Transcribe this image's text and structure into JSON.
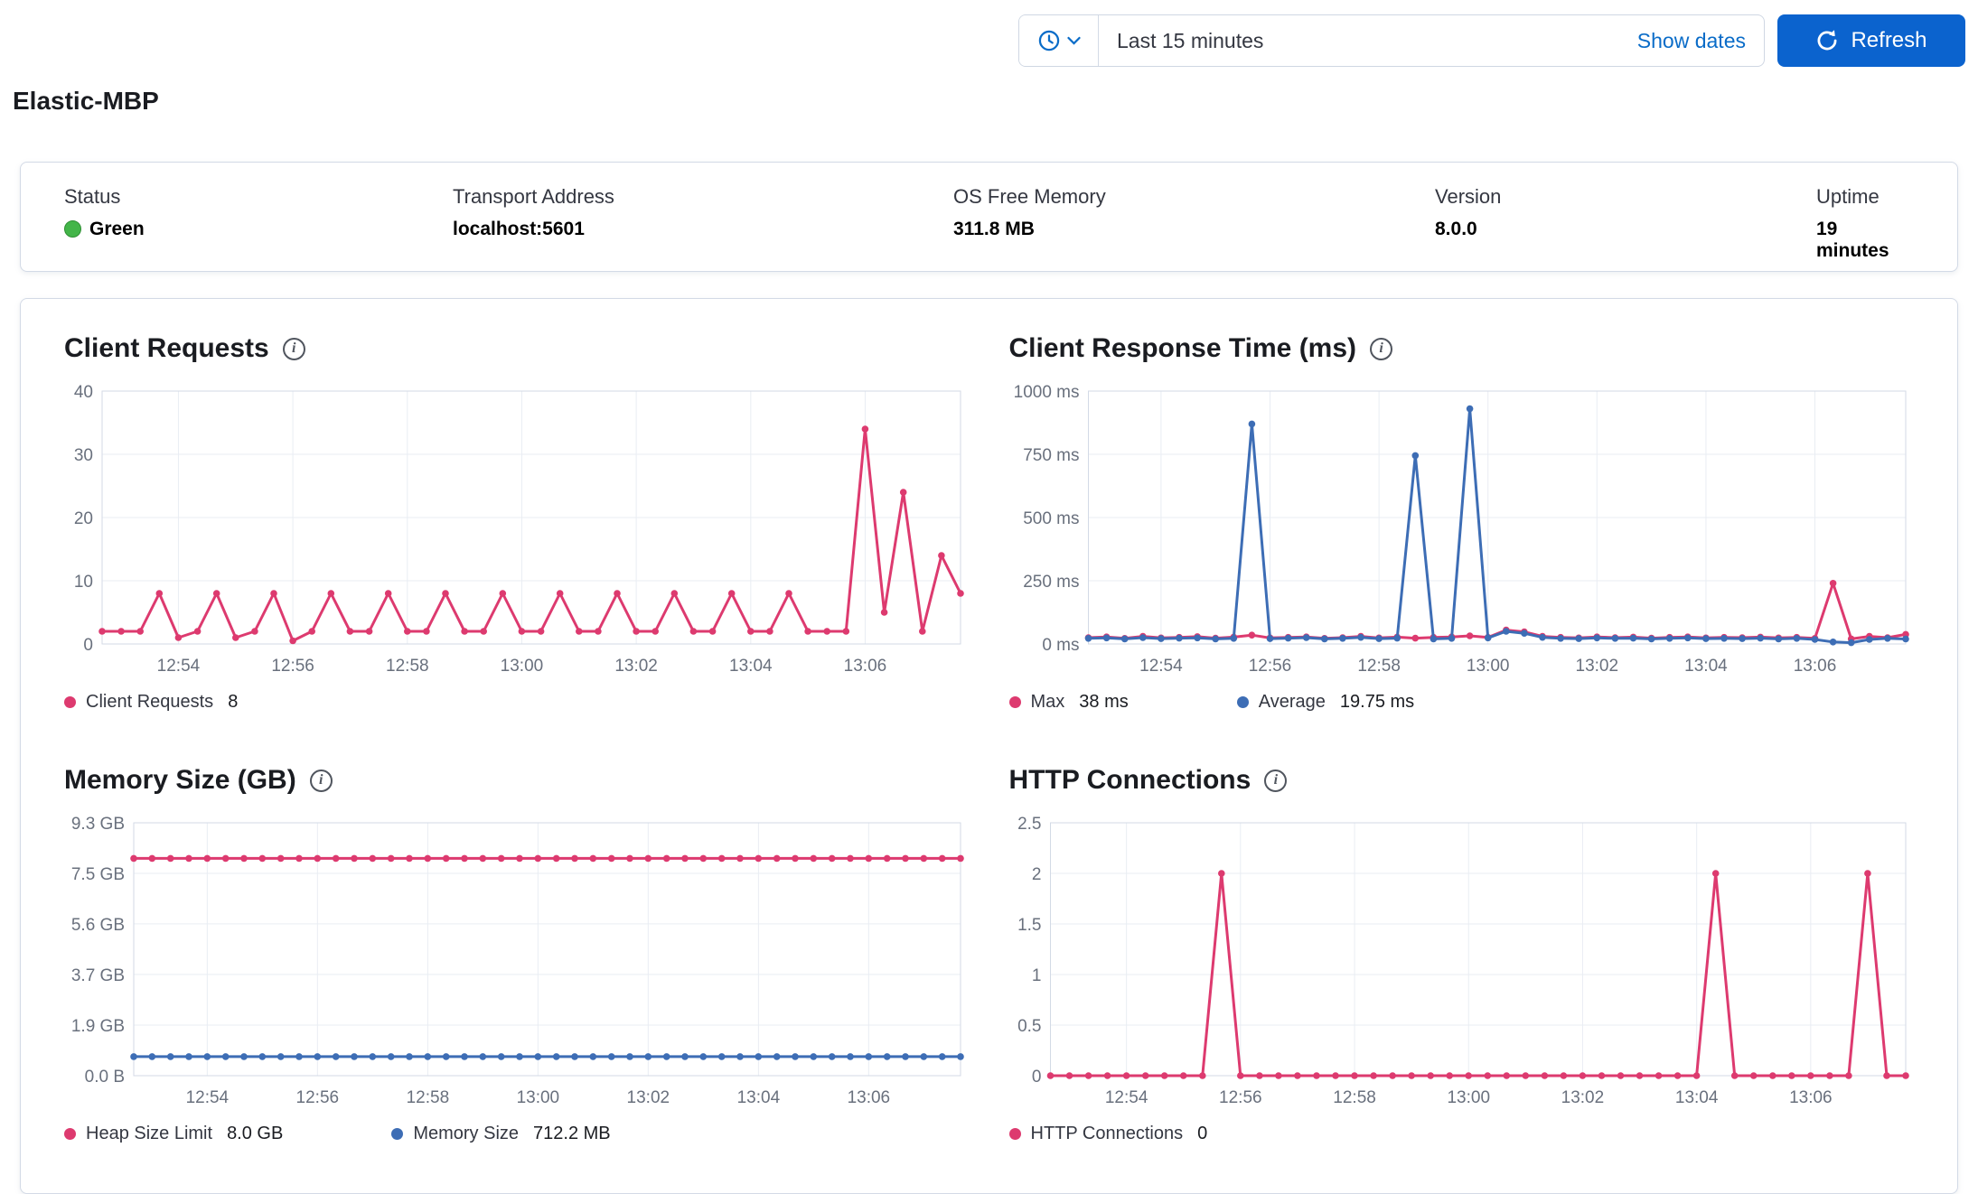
{
  "colors": {
    "pink": "#dd3a6f",
    "blue": "#3d6db5",
    "primary_button": "#0b63ce",
    "link": "#0a6cc8",
    "status_green": "#43b549"
  },
  "topbar": {
    "time_range": "Last 15 minutes",
    "show_dates_label": "Show dates",
    "refresh_label": "Refresh"
  },
  "page": {
    "title": "Elastic-MBP"
  },
  "status": {
    "items": [
      {
        "label": "Status",
        "value": "Green"
      },
      {
        "label": "Transport Address",
        "value": "localhost:5601"
      },
      {
        "label": "OS Free Memory",
        "value": "311.8 MB"
      },
      {
        "label": "Version",
        "value": "8.0.0"
      },
      {
        "label": "Uptime",
        "value": "19 minutes"
      }
    ]
  },
  "chart_data": [
    {
      "type": "line",
      "title": "Client Requests",
      "xlabel": "",
      "ylabel": "",
      "grid": true,
      "legend_position": "bottom",
      "y_max": 40,
      "y_ticks": [
        {
          "v": 40,
          "label": "40"
        },
        {
          "v": 30,
          "label": "30"
        },
        {
          "v": 20,
          "label": "20"
        },
        {
          "v": 10,
          "label": "10"
        },
        {
          "v": 0,
          "label": "0"
        }
      ],
      "x_ticks": [
        {
          "f": 0.0889,
          "label": "12:54"
        },
        {
          "f": 0.2222,
          "label": "12:56"
        },
        {
          "f": 0.3556,
          "label": "12:58"
        },
        {
          "f": 0.4889,
          "label": "13:00"
        },
        {
          "f": 0.6222,
          "label": "13:02"
        },
        {
          "f": 0.7556,
          "label": "13:04"
        },
        {
          "f": 0.8889,
          "label": "13:06"
        }
      ],
      "series": [
        {
          "name": "Client Requests",
          "legend_value": "8",
          "color": "#dd3a6f",
          "values": [
            2,
            2,
            2,
            8,
            1,
            2,
            8,
            1,
            2,
            8,
            0.5,
            2,
            8,
            2,
            2,
            8,
            2,
            2,
            8,
            2,
            2,
            8,
            2,
            2,
            8,
            2,
            2,
            8,
            2,
            2,
            8,
            2,
            2,
            8,
            2,
            2,
            8,
            2,
            2,
            2,
            34,
            5,
            24,
            2,
            14,
            8
          ]
        }
      ]
    },
    {
      "type": "line",
      "title": "Client Response Time (ms)",
      "xlabel": "",
      "ylabel": "",
      "grid": true,
      "legend_position": "bottom",
      "y_max": 1000,
      "y_ticks": [
        {
          "v": 1000,
          "label": "1000 ms"
        },
        {
          "v": 750,
          "label": "750 ms"
        },
        {
          "v": 500,
          "label": "500 ms"
        },
        {
          "v": 250,
          "label": "250 ms"
        },
        {
          "v": 0,
          "label": "0 ms"
        }
      ],
      "x_ticks": [
        {
          "f": 0.0889,
          "label": "12:54"
        },
        {
          "f": 0.2222,
          "label": "12:56"
        },
        {
          "f": 0.3556,
          "label": "12:58"
        },
        {
          "f": 0.4889,
          "label": "13:00"
        },
        {
          "f": 0.6222,
          "label": "13:02"
        },
        {
          "f": 0.7556,
          "label": "13:04"
        },
        {
          "f": 0.8889,
          "label": "13:06"
        }
      ],
      "series": [
        {
          "name": "Max",
          "legend_value": "38 ms",
          "color": "#dd3a6f",
          "values": [
            25,
            28,
            22,
            30,
            24,
            26,
            29,
            23,
            27,
            35,
            24,
            26,
            28,
            22,
            25,
            30,
            24,
            27,
            23,
            26,
            28,
            32,
            26,
            55,
            48,
            30,
            26,
            24,
            28,
            25,
            27,
            23,
            26,
            28,
            24,
            26,
            25,
            27,
            24,
            26,
            22,
            240,
            20,
            30,
            25,
            38
          ]
        },
        {
          "name": "Average",
          "legend_value": "19.75 ms",
          "color": "#3d6db5",
          "values": [
            22,
            24,
            20,
            25,
            21,
            23,
            24,
            20,
            22,
            870,
            21,
            23,
            25,
            20,
            22,
            26,
            21,
            23,
            745,
            20,
            22,
            930,
            24,
            50,
            42,
            26,
            22,
            21,
            24,
            22,
            23,
            20,
            22,
            24,
            21,
            22,
            21,
            23,
            20,
            22,
            18,
            8,
            5,
            18,
            22,
            19.75
          ]
        }
      ]
    },
    {
      "type": "line",
      "title": "Memory Size (GB)",
      "xlabel": "",
      "ylabel": "",
      "grid": true,
      "legend_position": "bottom",
      "y_max": 9.31,
      "y_ticks": [
        {
          "v": 9.31,
          "label": "9.3 GB"
        },
        {
          "v": 7.45,
          "label": "7.5 GB"
        },
        {
          "v": 5.59,
          "label": "5.6 GB"
        },
        {
          "v": 3.73,
          "label": "3.7 GB"
        },
        {
          "v": 1.86,
          "label": "1.9 GB"
        },
        {
          "v": 0,
          "label": "0.0 B"
        }
      ],
      "x_ticks": [
        {
          "f": 0.0889,
          "label": "12:54"
        },
        {
          "f": 0.2222,
          "label": "12:56"
        },
        {
          "f": 0.3556,
          "label": "12:58"
        },
        {
          "f": 0.4889,
          "label": "13:00"
        },
        {
          "f": 0.6222,
          "label": "13:02"
        },
        {
          "f": 0.7556,
          "label": "13:04"
        },
        {
          "f": 0.8889,
          "label": "13:06"
        }
      ],
      "series": [
        {
          "name": "Heap Size Limit",
          "legend_value": "8.0 GB",
          "color": "#dd3a6f",
          "values": [
            8,
            8,
            8,
            8,
            8,
            8,
            8,
            8,
            8,
            8,
            8,
            8,
            8,
            8,
            8,
            8,
            8,
            8,
            8,
            8,
            8,
            8,
            8,
            8,
            8,
            8,
            8,
            8,
            8,
            8,
            8,
            8,
            8,
            8,
            8,
            8,
            8,
            8,
            8,
            8,
            8,
            8,
            8,
            8,
            8,
            8
          ]
        },
        {
          "name": "Memory Size",
          "legend_value": "712.2 MB",
          "color": "#3d6db5",
          "values": [
            0.7,
            0.7,
            0.7,
            0.7,
            0.7,
            0.7,
            0.7,
            0.7,
            0.7,
            0.7,
            0.7,
            0.7,
            0.7,
            0.7,
            0.7,
            0.7,
            0.7,
            0.7,
            0.7,
            0.7,
            0.7,
            0.7,
            0.7,
            0.7,
            0.7,
            0.7,
            0.7,
            0.7,
            0.7,
            0.7,
            0.7,
            0.7,
            0.7,
            0.7,
            0.7,
            0.7,
            0.7,
            0.7,
            0.7,
            0.7,
            0.7,
            0.7,
            0.7,
            0.7,
            0.7,
            0.7
          ]
        }
      ]
    },
    {
      "type": "line",
      "title": "HTTP Connections",
      "xlabel": "",
      "ylabel": "",
      "grid": true,
      "legend_position": "bottom",
      "y_max": 2.5,
      "y_ticks": [
        {
          "v": 2.5,
          "label": "2.5"
        },
        {
          "v": 2,
          "label": "2"
        },
        {
          "v": 1.5,
          "label": "1.5"
        },
        {
          "v": 1,
          "label": "1"
        },
        {
          "v": 0.5,
          "label": "0.5"
        },
        {
          "v": 0,
          "label": "0"
        }
      ],
      "x_ticks": [
        {
          "f": 0.0889,
          "label": "12:54"
        },
        {
          "f": 0.2222,
          "label": "12:56"
        },
        {
          "f": 0.3556,
          "label": "12:58"
        },
        {
          "f": 0.4889,
          "label": "13:00"
        },
        {
          "f": 0.6222,
          "label": "13:02"
        },
        {
          "f": 0.7556,
          "label": "13:04"
        },
        {
          "f": 0.8889,
          "label": "13:06"
        }
      ],
      "series": [
        {
          "name": "HTTP Connections",
          "legend_value": "0",
          "color": "#dd3a6f",
          "values": [
            0,
            0,
            0,
            0,
            0,
            0,
            0,
            0,
            0,
            2,
            0,
            0,
            0,
            0,
            0,
            0,
            0,
            0,
            0,
            0,
            0,
            0,
            0,
            0,
            0,
            0,
            0,
            0,
            0,
            0,
            0,
            0,
            0,
            0,
            0,
            2,
            0,
            0,
            0,
            0,
            0,
            0,
            0,
            2,
            0,
            0
          ]
        }
      ]
    }
  ]
}
